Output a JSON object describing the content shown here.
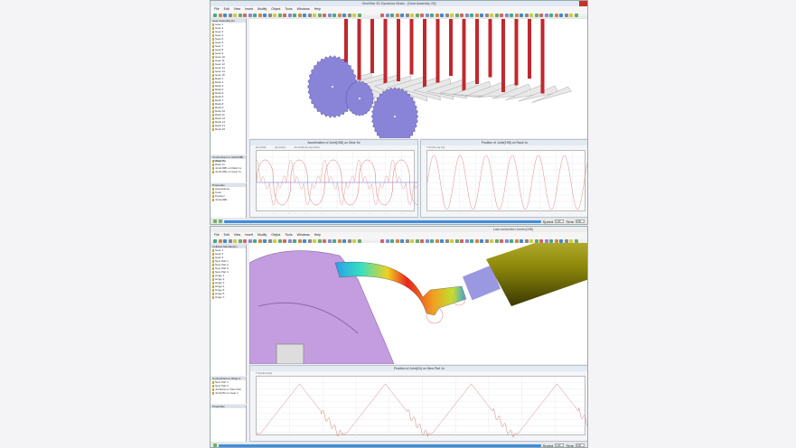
{
  "top_window": {
    "title": "OmniStar 3D Dynamics Studio - [Gear Assembly 2D]",
    "menu": [
      "File",
      "Edit",
      "View",
      "Insert",
      "Modify",
      "Object",
      "Tools",
      "Windows",
      "Help"
    ],
    "tree_header": "Gear Assembly [1]",
    "tree_items": [
      "Gear 1",
      "Gear 2",
      "Gear 3",
      "Gear 4",
      "Gear 5",
      "Gear 6",
      "Gear 7",
      "Gear 8",
      "Gear 9",
      "Gear 10",
      "Gear 11",
      "Gear 12",
      "Gear 13",
      "Gear 14",
      "Gear 15",
      "Rack 1",
      "Rack 2",
      "Rack 3",
      "Rack 4",
      "Rack 5",
      "Rack 6",
      "Rack 7",
      "Rack 8",
      "Rack 9",
      "Rack 10",
      "Rack 11",
      "Rack 12",
      "Rack 13",
      "Rack 14",
      "Rack 15"
    ],
    "connections_header": "Connections to Joint(198) on Gear Sx",
    "connections": [
      "Rack 1x",
      "Rack 1x",
      "Joint(198) on Rack 1x",
      "Joint(199) on Gear 1x"
    ],
    "properties_header": "Properties",
    "properties": [
      "Appearance",
      "Color",
      "Position",
      "Joint(198)"
    ],
    "chart_left": {
      "title": "Acceleration of Joint(198) on Gear Sx",
      "legend": [
        "Ax (m/s²)",
        "Ay (m/s²)",
        "Az (m/s²)  Ax, Ay (m/s²)"
      ]
    },
    "chart_right": {
      "title": "Position of Joint(198) on Rack 1x",
      "legend": [
        "Y (m)  Ax, Ay (m)"
      ]
    },
    "status": {
      "speed_label": "Speed",
      "speed_value": "1.00",
      "time_label": "Time",
      "time_value": "0.00"
    }
  },
  "bottom_window": {
    "status_text": "Last connection Jointrx(198)",
    "menu": [
      "File",
      "Edit",
      "View",
      "Insert",
      "Modify",
      "Object",
      "Tools",
      "Windows",
      "Help"
    ],
    "tree_header": "Collision Mechanism",
    "tree_items": [
      "Gear 1",
      "Gear 2",
      "Gear 3",
      "New Part 1",
      "New Part 2",
      "New Part 3",
      "New Part 4",
      "Hinge 1",
      "Hinge 2",
      "Hinge 3",
      "Hinge 4",
      "Hinge 5",
      "Hinge 6",
      "Hinge 7"
    ],
    "connections_header": "Connections to Hinge 4",
    "connections": [
      "New Part 1",
      "New Part 2",
      "Joint(24) on New Part",
      "Joint(25) on Gear 1"
    ],
    "properties_header": "Properties",
    "chart": {
      "title": "Position of Joint(24) on New Part 1x",
      "legend": [
        "Y (m)  Ax (m/s)"
      ]
    },
    "status": {
      "speed_label": "Speed",
      "speed_value": "1.00",
      "time_label": "Time",
      "time_value": "0.00"
    }
  },
  "colors": {
    "gear": "#8a84d8",
    "rod": "#c0282e",
    "fem_red": "#e8251c",
    "fem_blue": "#2a9ee8",
    "cylinder": "#8f8a0c",
    "wheel": "#c49ce0",
    "progress": "#3c8ee0"
  }
}
